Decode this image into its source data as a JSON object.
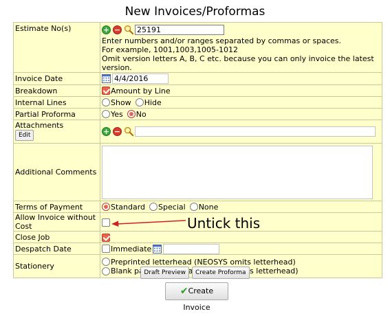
{
  "page": {
    "title": "New Invoices/Proformas"
  },
  "form": {
    "estimate": {
      "label": "Estimate No(s)",
      "value": "25191",
      "help1": "Enter numbers and/or ranges separated by commas or spaces.",
      "help2": "For example, 1001,1003,1005-1012",
      "help3": "Omit version letters A, B, C etc. because you can only invoice the latest version."
    },
    "invoice_date": {
      "label": "Invoice Date",
      "value": "4/4/2016"
    },
    "breakdown": {
      "label": "Breakdown",
      "option": "Amount by Line",
      "checked": true
    },
    "internal_lines": {
      "label": "Internal Lines",
      "options": [
        "Show",
        "Hide"
      ],
      "selected": null
    },
    "partial_proforma": {
      "label": "Partial Proforma",
      "options": [
        "Yes",
        "No"
      ],
      "selected": "No"
    },
    "attachments": {
      "label": "Attachments",
      "edit_label": "Edit",
      "value": ""
    },
    "additional_comments": {
      "label": "Additional Comments",
      "value": ""
    },
    "terms_of_payment": {
      "label": "Terms of Payment",
      "options": [
        "Standard",
        "Special",
        "None"
      ],
      "selected": "Standard"
    },
    "allow_invoice_without_cost": {
      "label": "Allow Invoice without Cost",
      "checked": false
    },
    "close_job": {
      "label": "Close Job",
      "checked": true
    },
    "despatch_date": {
      "label": "Despatch Date",
      "immediate_label": "Immediate",
      "immediate_checked": false,
      "value": ""
    },
    "stationery": {
      "label": "Stationery",
      "options": [
        "Preprinted letterhead (NEOSYS omits letterhead)",
        "Blank paper/PDF/Email (NEOSYS adds letterhead)"
      ],
      "selected": null
    }
  },
  "annotation": {
    "text": "Untick this",
    "color": "#d02020"
  },
  "buttons": {
    "draft_preview": "Draft Preview",
    "create_proforma": "Create Proforma",
    "create_invoice": "Create Invoice"
  },
  "colors": {
    "form_bg": "#ffffcc",
    "accent": "#e8664e",
    "plus": "#3aa83a",
    "minus": "#d93a2a"
  }
}
